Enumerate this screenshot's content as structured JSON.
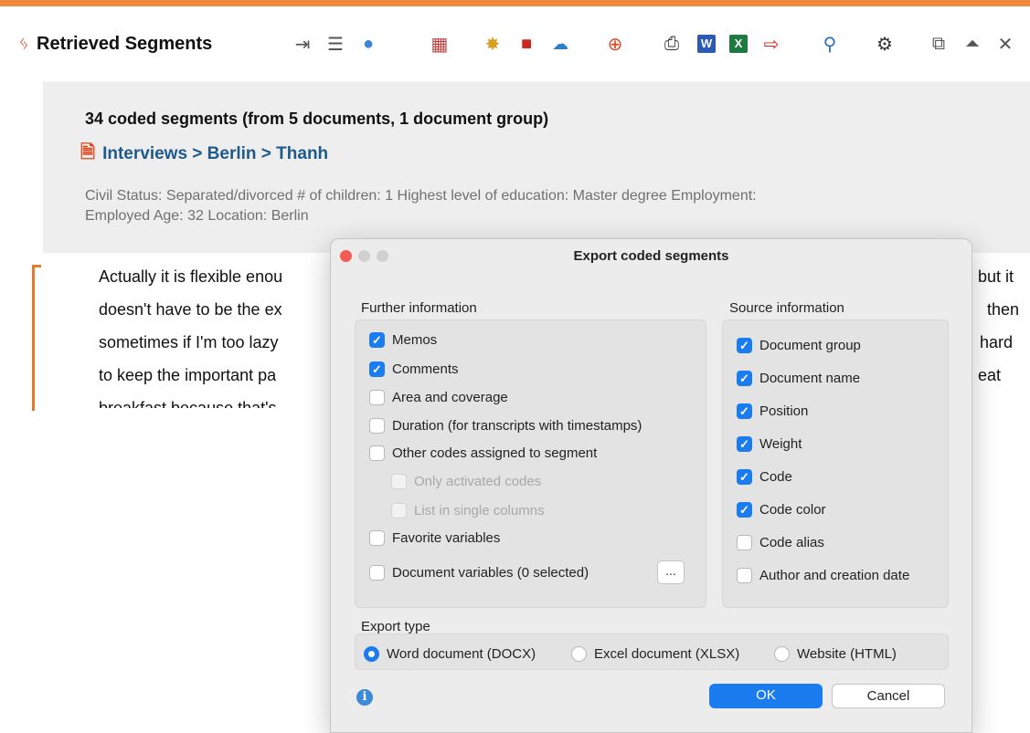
{
  "toolbar": {
    "title": "Retrieved Segments",
    "icons": [
      "code-icon",
      "export-segments-icon",
      "list-view-icon",
      "comment-icon",
      "code-matrix-icon",
      "code-highlight-icon",
      "color-icon",
      "abc-icon",
      "add-code-icon",
      "print-icon",
      "word-icon",
      "excel-icon",
      "export-icon",
      "search-icon",
      "gear-icon",
      "undock-icon",
      "collapse-icon",
      "close-icon"
    ],
    "accent_color": "#f08a3c"
  },
  "main": {
    "segment_count": "34 coded segments (from 5 documents, 1 document group)",
    "document_path": "Interviews > Berlin > Thanh",
    "variables_line1": "Civil Status: Separated/divorced   # of children: 1   Highest level of education: Master degree   Employment:",
    "variables_line2": "Employed   Age: 32   Location: Berlin",
    "text_left": [
      "Actually it is flexible enou",
      "doesn't have to be the ex",
      "sometimes if I'm too lazy",
      "to keep the important pa",
      "breakfast because that's"
    ],
    "text_right": [
      "but it",
      "then",
      "hard",
      "eat"
    ]
  },
  "dialog": {
    "title": "Export coded segments",
    "further": {
      "label": "Further information",
      "memos": "Memos",
      "comments": "Comments",
      "area": "Area and coverage",
      "duration": "Duration (for transcripts with timestamps)",
      "other_codes": "Other codes assigned to segment",
      "only_activated": "Only activated codes",
      "single_columns": "List in single columns",
      "favorite": "Favorite variables",
      "doc_vars": "Document variables (0 selected)",
      "ellipsis": "..."
    },
    "source": {
      "label": "Source information",
      "doc_group": "Document group",
      "doc_name": "Document name",
      "position": "Position",
      "weight": "Weight",
      "code": "Code",
      "code_color": "Code color",
      "code_alias": "Code alias",
      "author": "Author and creation date"
    },
    "export": {
      "label": "Export type",
      "word": "Word document (DOCX)",
      "excel": "Excel document (XLSX)",
      "html": "Website (HTML)"
    },
    "ok": "OK",
    "cancel": "Cancel",
    "info_glyph": "i"
  }
}
